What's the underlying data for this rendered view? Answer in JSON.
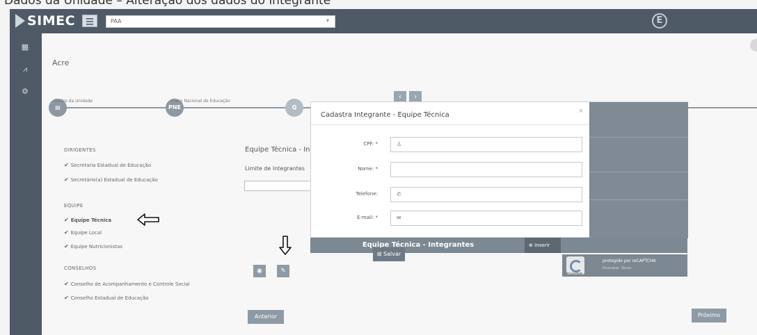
{
  "caption": "Dados da Unidade – Alteração dos dados do integrante",
  "topbar": {
    "logo_text": "SIMEC",
    "program_value": "PAA"
  },
  "main": {
    "state_title": "Acre",
    "stepper": [
      {
        "badge": "",
        "label": "Dados da Unidade"
      },
      {
        "badge": "PNE",
        "label": "Plano Nacional de Educação"
      },
      {
        "badge": "Q",
        "label": ""
      }
    ],
    "groups": [
      {
        "title": "DIRIGENTES",
        "items": [
          "Secretaria Estadual de Educação",
          "Secretário(a) Estadual de Educação"
        ]
      },
      {
        "title": "EQUIPE",
        "items": [
          "Equipe Técnica",
          "Equipe Local",
          "Equipe Nutricionistas"
        ]
      },
      {
        "title": "CONSELHOS",
        "items": [
          "Conselho de Acompanhamento e Controle Social",
          "Conselho Estadual de Educação"
        ]
      }
    ],
    "section_title": "Equipe Técnica - In",
    "limit_label": "Limite de Integrantes",
    "grid_title": "Equipe Técnica - Integrantes",
    "insert_label": "Inserir",
    "captcha_text": "protegido por reCAPTCHA",
    "captcha_sub": "Privacidade - Termos",
    "captcha_logo_label": "Privacidade",
    "prev_label": "Anterior",
    "next_label": "Próximo"
  },
  "modal": {
    "title": "Cadastra Integrante - Equipe Técnica",
    "close": "×",
    "fields": [
      {
        "label": "CPF: *",
        "icon": "user-icon",
        "value": ""
      },
      {
        "label": "Nome: *",
        "icon": "",
        "value": ""
      },
      {
        "label": "Telefone:",
        "icon": "phone-icon",
        "value": ""
      },
      {
        "label": "E-mail: *",
        "icon": "envelope-icon",
        "value": ""
      }
    ],
    "save_label": "Salvar"
  }
}
